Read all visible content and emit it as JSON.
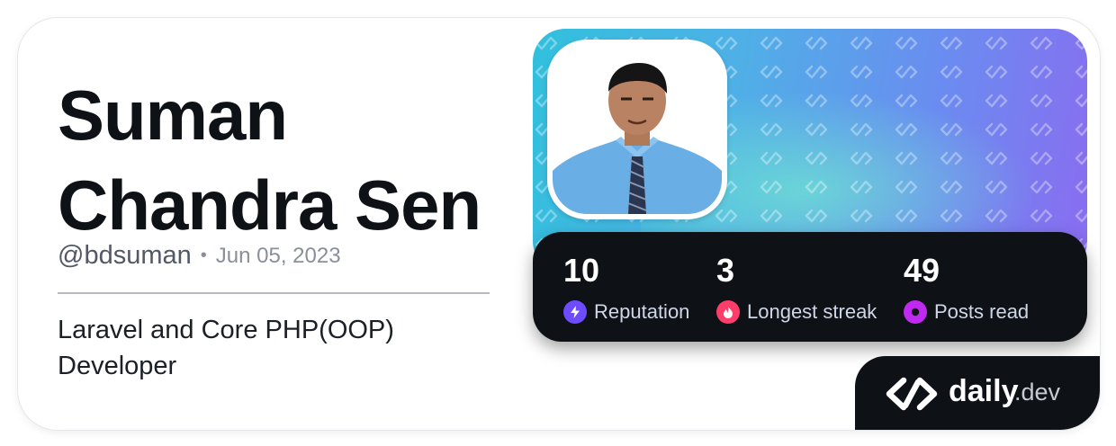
{
  "profile": {
    "name_line1": "Suman",
    "name_line2": "Chandra Sen",
    "handle": "@bdsuman",
    "separator": "•",
    "joined": "Jun 05, 2023",
    "bio": "Laravel and Core PHP(OOP) Developer"
  },
  "stats": [
    {
      "value": "10",
      "label": "Reputation",
      "icon": "reputation-icon",
      "color": "#6e4bff"
    },
    {
      "value": "3",
      "label": "Longest streak",
      "icon": "streak-flame-icon",
      "color": "#ff3d6b"
    },
    {
      "value": "49",
      "label": "Posts read",
      "icon": "posts-read-icon",
      "color": "#c029f0"
    }
  ],
  "brand": {
    "name": "daily",
    "suffix": ".dev"
  },
  "colors": {
    "cover_start": "#31c0dd",
    "cover_end": "#8a6cf0",
    "dark": "#0e1217"
  }
}
